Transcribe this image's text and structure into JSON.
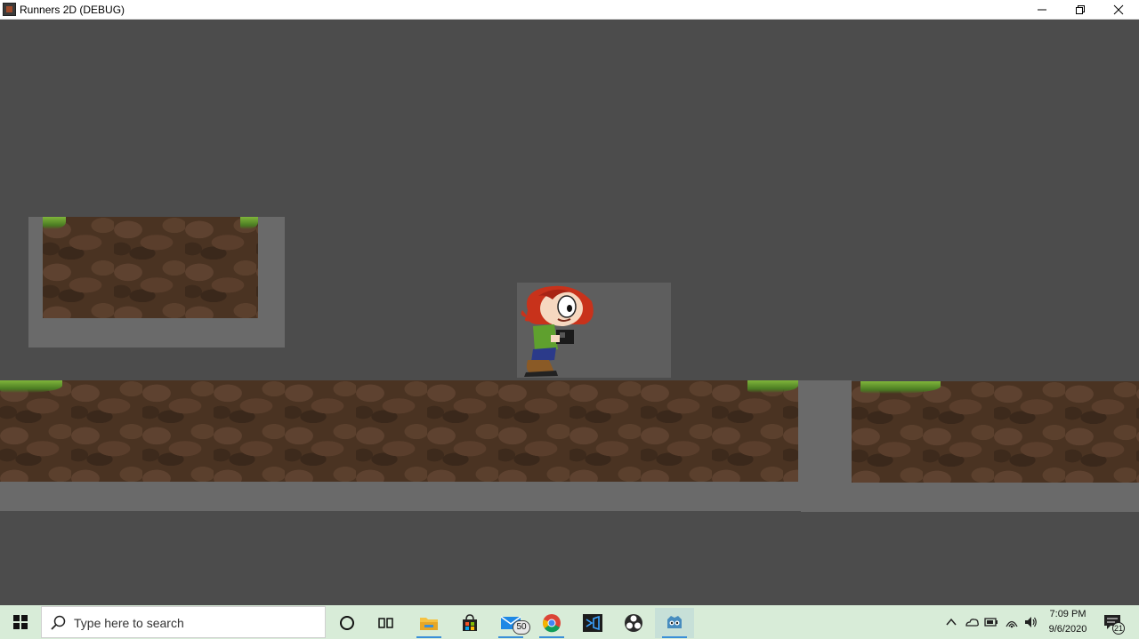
{
  "window": {
    "title": "Runners 2D (DEBUG)"
  },
  "taskbar": {
    "search_placeholder": "Type here to search",
    "mail_badge": "50",
    "notification_count": "21",
    "clock_time": "7:09 PM",
    "clock_date": "9/6/2020",
    "pinned_apps": [
      "task-view",
      "file-explorer",
      "microsoft-store",
      "mail",
      "chrome",
      "visual-studio",
      "obs",
      "godot"
    ]
  },
  "colors": {
    "background": "#4c4c4c",
    "collider": "#6a6a6a",
    "dirt": "#4a3322",
    "grass": "#6fa52e",
    "taskbar": "#d8ecd8",
    "accent": "#3a8fd8"
  }
}
